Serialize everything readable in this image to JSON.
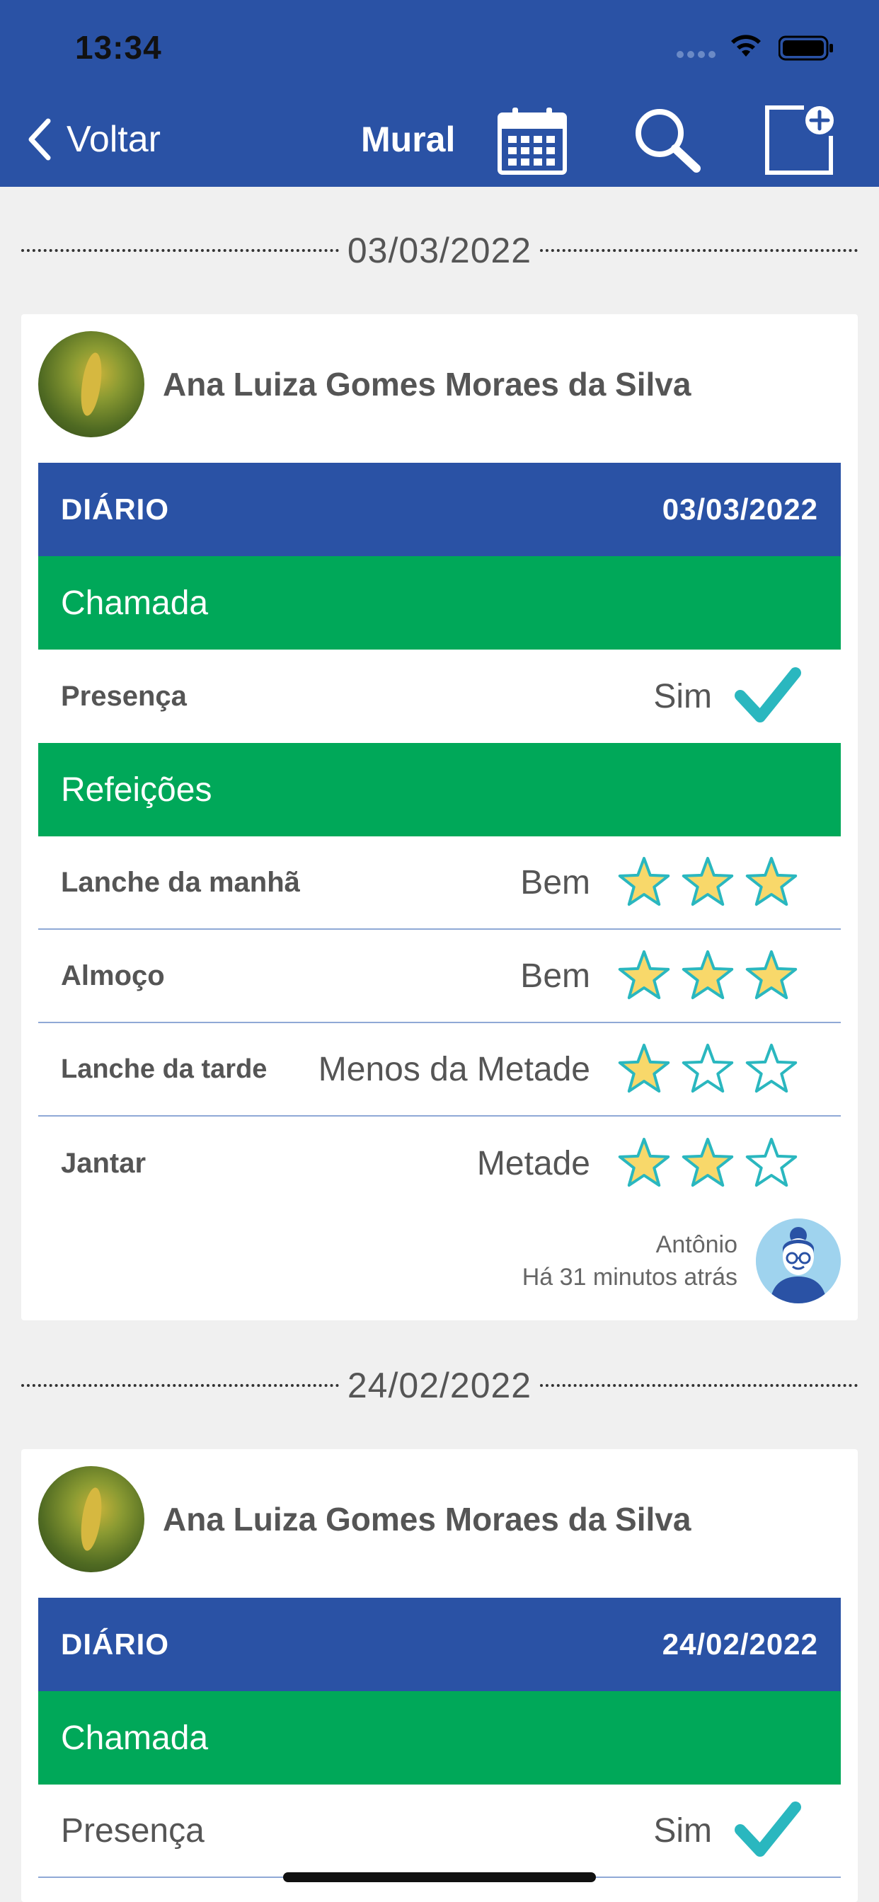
{
  "status_bar": {
    "time": "13:34"
  },
  "nav": {
    "back_label": "Voltar",
    "title": "Mural",
    "icons": [
      "calendar-icon",
      "search-icon",
      "new-post-icon"
    ]
  },
  "entries": [
    {
      "date": "03/03/2022",
      "student_name": "Ana Luiza Gomes Moraes da Silva",
      "header_label": "DIÁRIO",
      "header_date": "03/03/2022",
      "attendance": {
        "section": "Chamada",
        "label": "Presença",
        "value": "Sim"
      },
      "meals": {
        "section": "Refeições",
        "items": [
          {
            "label": "Lanche da manhã",
            "value": "Bem",
            "rating": 3
          },
          {
            "label": "Almoço",
            "value": "Bem",
            "rating": 3
          },
          {
            "label": "Lanche da tarde",
            "value": "Menos da Metade",
            "rating": 1
          },
          {
            "label": "Jantar",
            "value": "Metade",
            "rating": 2
          }
        ]
      },
      "author": "Antônio",
      "time_ago": "Há 31 minutos atrás"
    },
    {
      "date": "24/02/2022",
      "student_name": "Ana Luiza Gomes Moraes da Silva",
      "header_label": "DIÁRIO",
      "header_date": "24/02/2022",
      "attendance": {
        "section": "Chamada",
        "label": "Presença",
        "value": "Sim"
      }
    }
  ],
  "colors": {
    "header_blue": "#2a52a5",
    "section_green": "#00a859",
    "star_fill": "#f8d86a",
    "star_outline": "#2ab7bf",
    "check": "#2ab7bf"
  }
}
